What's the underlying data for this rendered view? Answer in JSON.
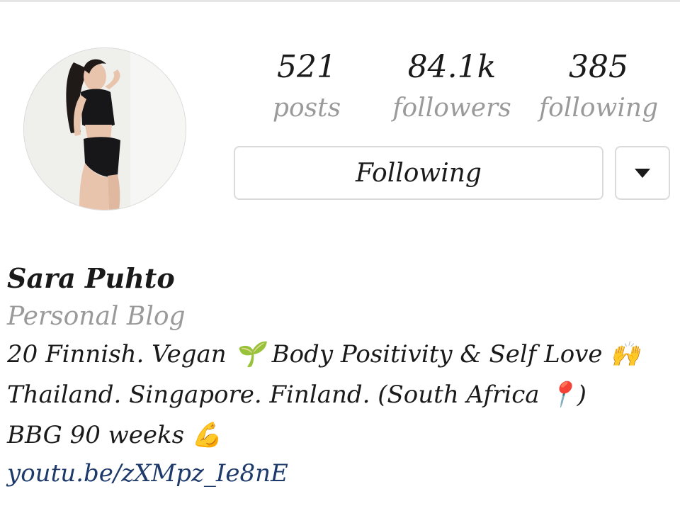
{
  "profile": {
    "stats": {
      "posts_value": "521",
      "posts_label": "posts",
      "followers_value": "84.1k",
      "followers_label": "followers",
      "following_value": "385",
      "following_label": "following"
    },
    "follow_button_label": "Following",
    "dropdown_icon": "caret-down",
    "name": "Sara Puhto",
    "category": "Personal Blog",
    "bio": {
      "line1": "20 Finnish. Vegan 🌱 Body Positivity & Self Love 🙌",
      "line2": "Thailand. Singapore. Finland. (South Africa 📍)",
      "line3": "BBG 90 weeks 💪"
    },
    "link": "youtu.be/zXMpz_Ie8nE"
  }
}
